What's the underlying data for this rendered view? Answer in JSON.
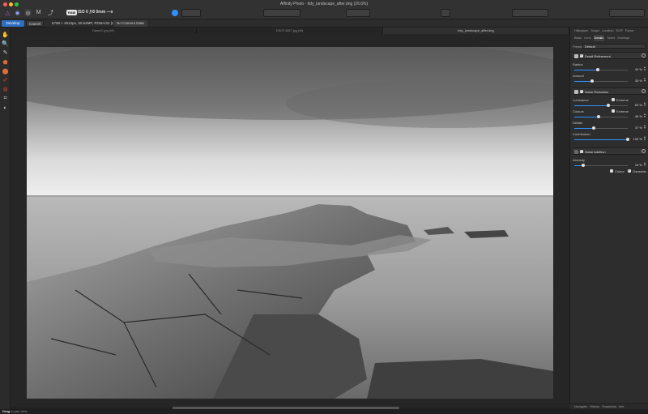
{
  "window": {
    "title": "Affinity Photo - tidy_landscape_after.dng (26.6%)"
  },
  "titlebar": {
    "personas": [
      "photo-persona-icon",
      "liquify-persona-icon",
      "develop-persona-icon",
      "tone-mapping-persona-icon",
      "export-persona-icon"
    ],
    "raw_badge": "RAW",
    "exif": "ISO 0 ƒ/0 0mm —s"
  },
  "contextbar": {
    "develop_label": "Develop",
    "cancel_label": "Cancel",
    "info": "6768 × 4512px, 30.54MP, RGBA/32 (HDR) · RAW",
    "camera": "No Camera Data"
  },
  "tabs": [
    {
      "label": "DawnC.jpg (M)",
      "active": false
    },
    {
      "label": "DSCF4357.jpg (M)",
      "active": false
    },
    {
      "label": "tidy_landscape_after.dng",
      "active": true
    }
  ],
  "panel": {
    "top_tabs": [
      "Histogram",
      "Scope",
      "Location",
      "EXIF",
      "Focus"
    ],
    "sub_tabs": [
      "Basic",
      "Lens",
      "Details",
      "Tones",
      "Overlays"
    ],
    "active_sub_tab": "Details",
    "preset_label": "Preset:",
    "preset_value": "Default",
    "sections": {
      "detail": {
        "title": "Detail Refinement",
        "params": [
          {
            "label": "Radius",
            "value": "44 %",
            "level": 0.44
          },
          {
            "label": "Amount",
            "value": "33 %",
            "level": 0.33
          }
        ]
      },
      "noise": {
        "title": "Noise Reduction",
        "params": [
          {
            "label": "Luminance",
            "value": "63 %",
            "level": 0.63,
            "option": "Extreme"
          },
          {
            "label": "Colours",
            "value": "46 %",
            "level": 0.46,
            "option": "Extreme"
          },
          {
            "label": "Details",
            "value": "37 %",
            "level": 0.37
          },
          {
            "label": "Contribution",
            "value": "100 %",
            "level": 1.0
          }
        ]
      },
      "addnoise": {
        "title": "Noise Addition",
        "params": [
          {
            "label": "Intensity",
            "value": "16 %",
            "level": 0.16
          }
        ],
        "options": [
          "Colour",
          "Gaussian"
        ]
      }
    },
    "bottom_tabs": [
      "Navigator",
      "History",
      "Snapshots",
      "Info"
    ]
  },
  "statusbar": {
    "hint": "Drag",
    "hint_rest": " to pan view."
  },
  "colors": {
    "accent": "#2f6fc2",
    "slider": "#2f8fff",
    "panel": "#2d2d2d"
  }
}
